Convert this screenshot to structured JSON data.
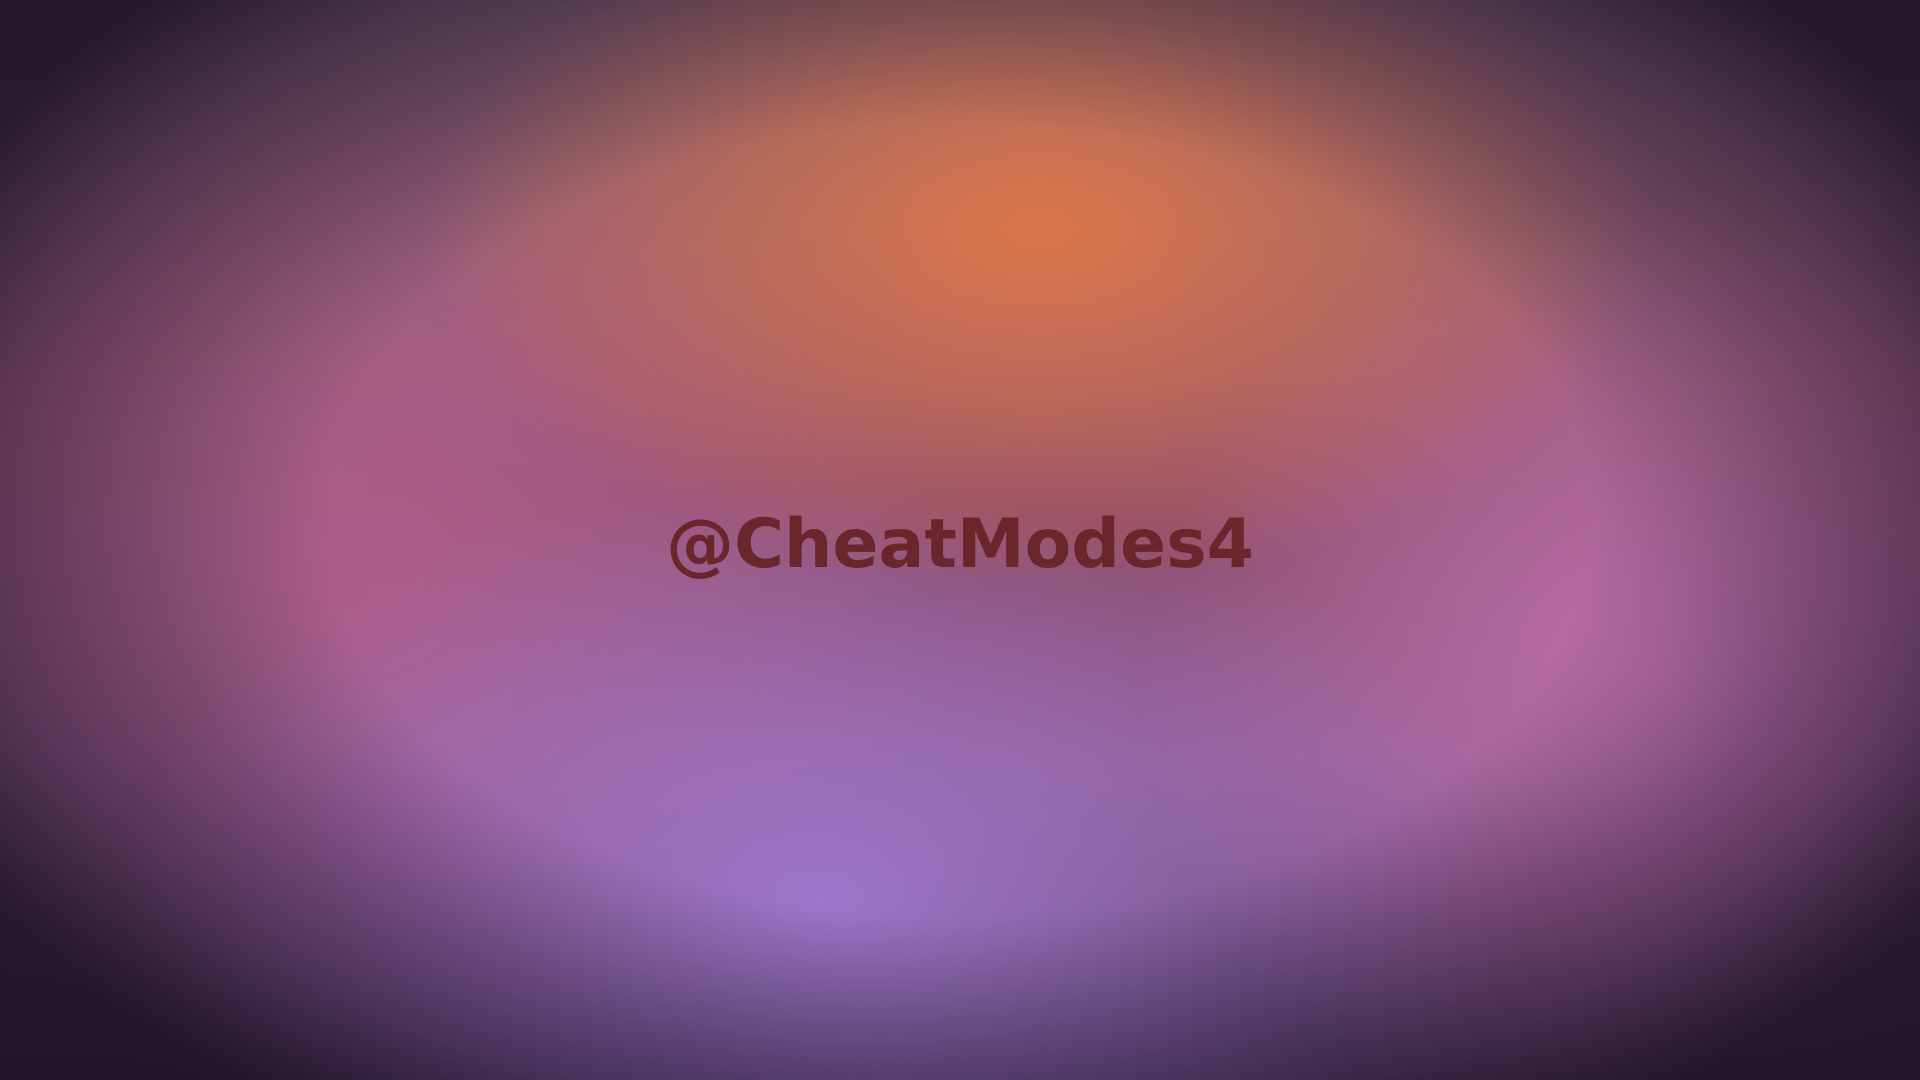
{
  "desktop": {
    "watermark_text": "@CheatModes4",
    "watermark_color": "#6b262c",
    "palette": {
      "top_glow": "#de7848",
      "bottom_glow": "#a078cd",
      "right_glow": "#be70ac",
      "left_glow": "#af5e8c",
      "edge_dark": "#2a1b32"
    }
  }
}
